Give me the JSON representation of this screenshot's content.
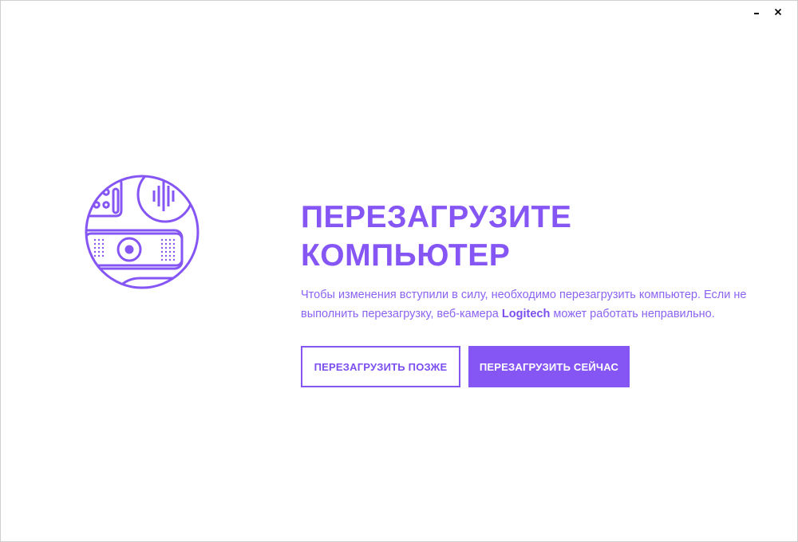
{
  "window": {
    "minimize_icon": "minimize-icon",
    "close_icon": "close-icon"
  },
  "illustration": {
    "icon": "webcam-illustration-icon"
  },
  "dialog": {
    "title_line1": "ПЕРЕЗАГРУЗИТЕ",
    "title_line2": "КОМПЬЮТЕР",
    "description_part1": "Чтобы изменения вступили в силу, необходимо перезагрузить компьютер. Если не выполнить перезагрузку, веб-камера ",
    "description_brand": "Logitech",
    "description_part2": " может работать неправильно.",
    "restart_later_label": "ПЕРЕЗАГРУЗИТЬ ПОЗЖЕ",
    "restart_now_label": "ПЕРЕЗАГРУЗИТЬ СЕЙЧАС"
  },
  "colors": {
    "accent": "#8656f5",
    "text_accent": "#8a63f2",
    "background": "#ffffff"
  }
}
